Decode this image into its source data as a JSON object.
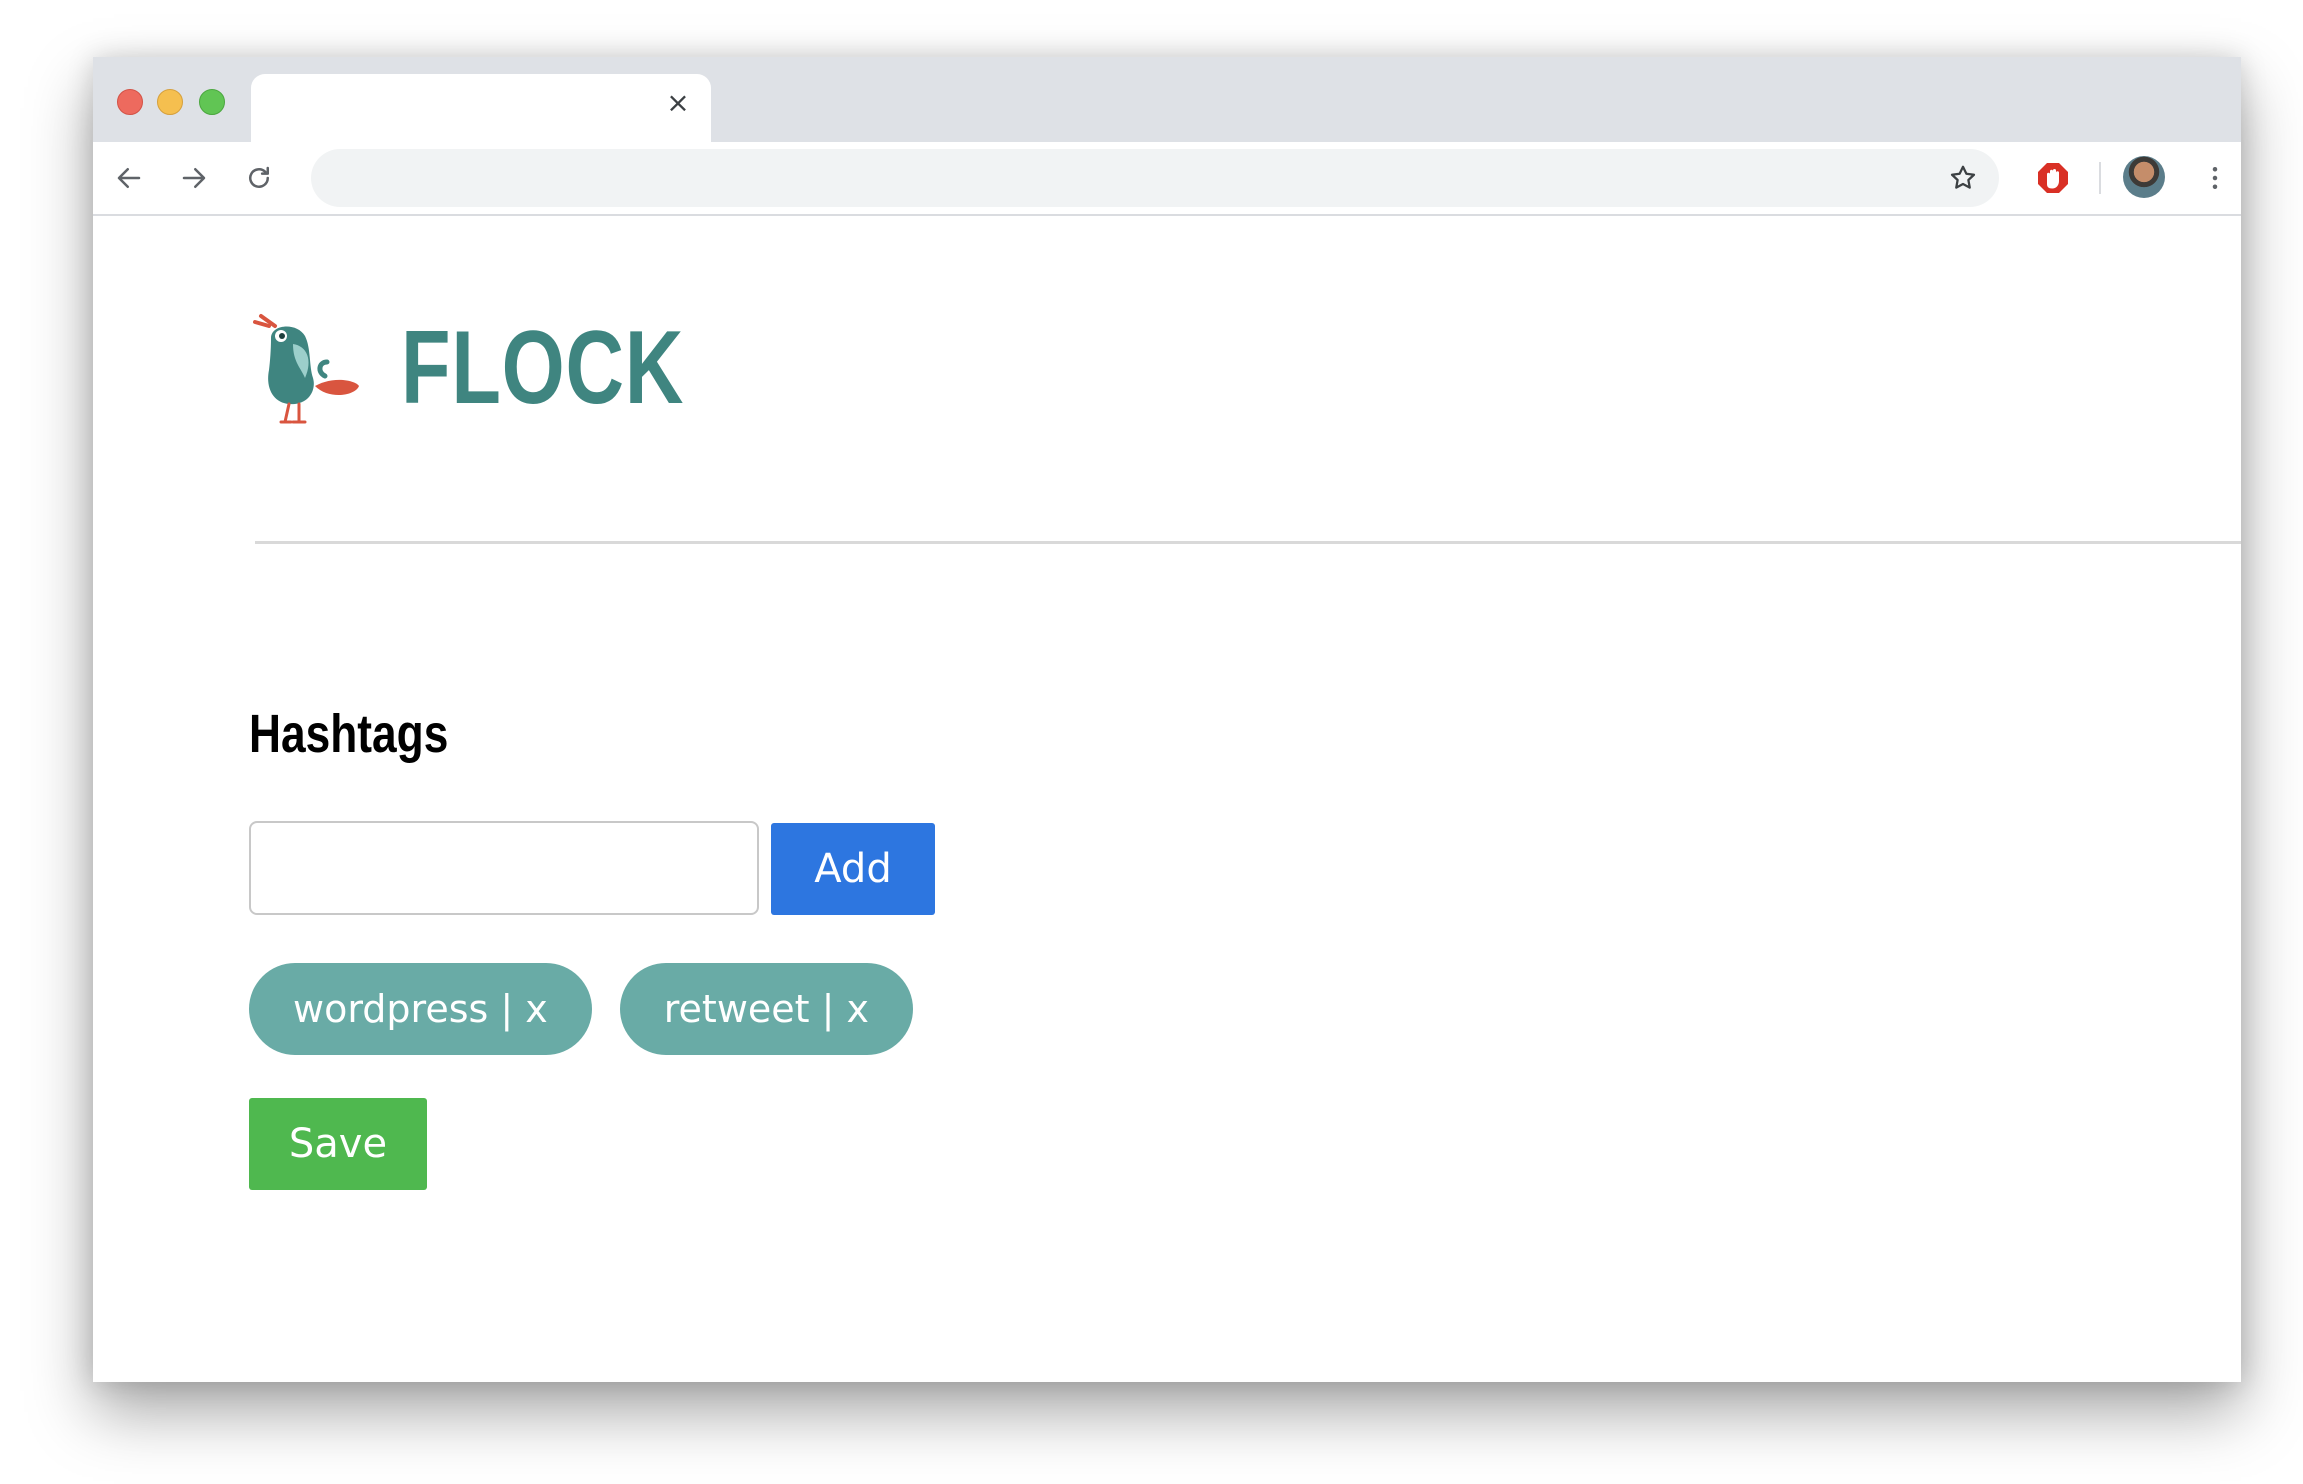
{
  "browser": {
    "tab_close_glyph": "×",
    "address_value": "",
    "icons": [
      "back-arrow-icon",
      "forward-arrow-icon",
      "reload-icon",
      "star-icon",
      "adblock-icon",
      "kebab-menu-icon"
    ]
  },
  "brand": {
    "name": "FLOCK",
    "accent_color": "#3f8580"
  },
  "main": {
    "heading": "Hashtags",
    "input_value": "",
    "add_label": "Add",
    "add_color": "#2d76e0",
    "tags": [
      {
        "label": "wordpress | x"
      },
      {
        "label": "retweet | x"
      }
    ],
    "tag_color": "#69aba6",
    "save_label": "Save",
    "save_color": "#4fb84f"
  }
}
